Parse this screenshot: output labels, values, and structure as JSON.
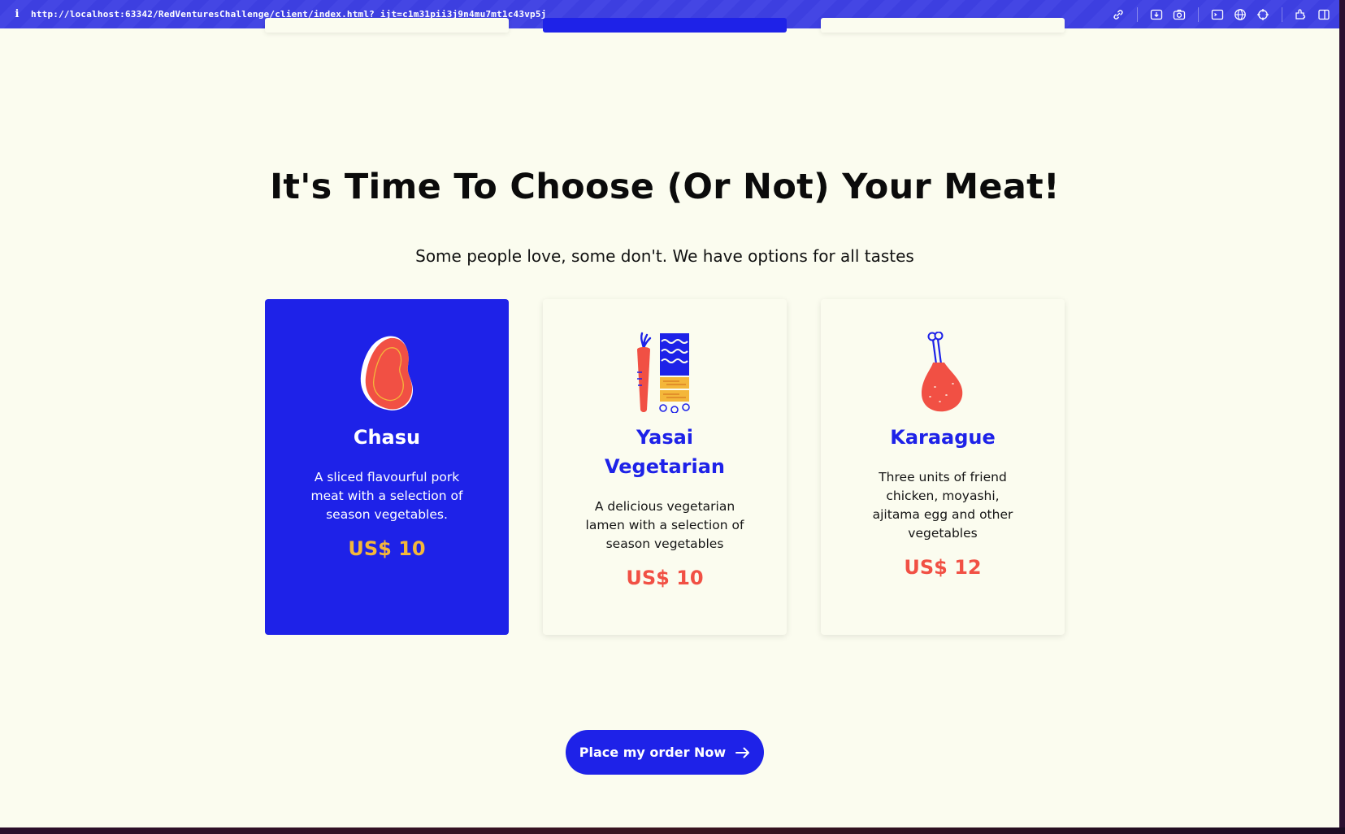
{
  "browser": {
    "url": "http://localhost:63342/RedVenturesChallenge/client/index.html?_ijt=c1m31pii3j9n4mu7mt1c43vp5j",
    "info_icon": "i",
    "toolbar_icons": [
      "link-icon",
      "download-icon",
      "camera-icon",
      "terminal-icon",
      "globe-icon",
      "crosshair-icon",
      "extensions-icon",
      "sidebar-icon"
    ]
  },
  "section": {
    "title": "It's Time To Choose (Or Not) Your Meat!",
    "subtitle": "Some people love, some don't. We have options for all tastes"
  },
  "cards": [
    {
      "name": "Chasu",
      "description": "A sliced flavourful pork meat with a selection of season vegetables.",
      "price": "US$ 10",
      "icon": "meat-steak-icon",
      "selected": true
    },
    {
      "name": "Yasai Vegetarian",
      "description": "A delicious vegetarian lamen with a selection of season vegetables",
      "price": "US$ 10",
      "icon": "vegetables-icon",
      "selected": false
    },
    {
      "name": "Karaague",
      "description": "Three units of friend chicken, moyashi, ajitama egg and other vegetables",
      "price": "US$ 12",
      "icon": "chicken-leg-icon",
      "selected": false
    }
  ],
  "order_button": {
    "label": "Place my order Now",
    "icon": "arrow-right-icon"
  },
  "colors": {
    "primary_blue": "#1e22e8",
    "accent_red": "#f15044",
    "accent_yellow": "#f4b73a",
    "background": "#fbfcef"
  }
}
